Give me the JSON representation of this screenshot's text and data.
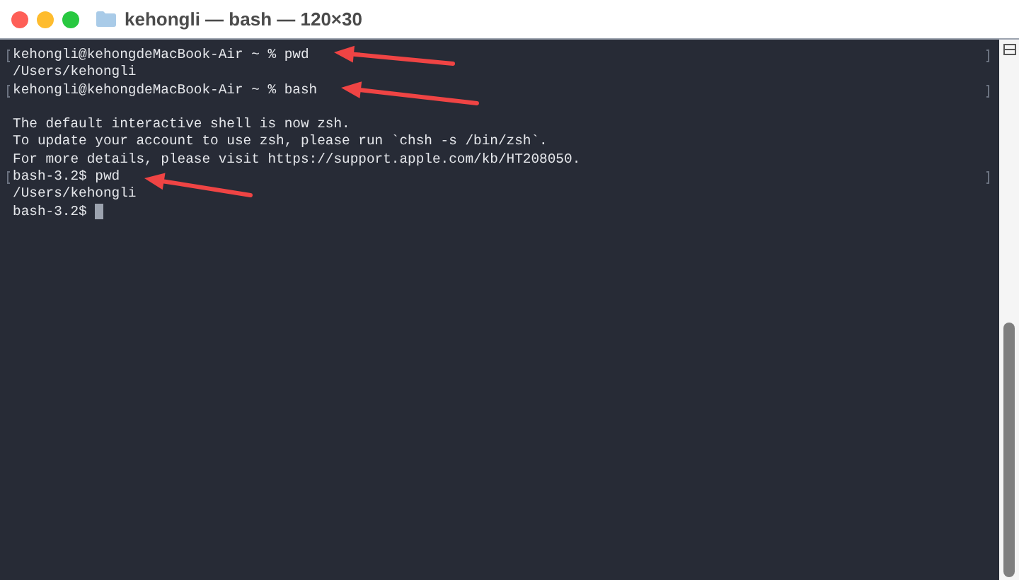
{
  "window": {
    "title": "kehongli — bash — 120×30"
  },
  "lines": [
    {
      "text": "kehongli@kehongdeMacBook-Air ~ % pwd",
      "marked": true,
      "cursor": false
    },
    {
      "text": "/Users/kehongli",
      "marked": false,
      "cursor": false
    },
    {
      "text": "kehongli@kehongdeMacBook-Air ~ % bash",
      "marked": true,
      "cursor": false
    },
    {
      "marked": false,
      "cursor": false
    },
    {
      "text": "The default interactive shell is now zsh.",
      "marked": false,
      "cursor": false
    },
    {
      "text": "To update your account to use zsh, please run `chsh -s /bin/zsh`.",
      "marked": false,
      "cursor": false
    },
    {
      "text": "For more details, please visit https://support.apple.com/kb/HT208050.",
      "marked": false,
      "cursor": false
    },
    {
      "text": "bash-3.2$ pwd",
      "marked": true,
      "cursor": false
    },
    {
      "text": "/Users/kehongli",
      "marked": false,
      "cursor": false
    },
    {
      "text": "bash-3.2$ ",
      "marked": false,
      "cursor": true
    }
  ]
}
